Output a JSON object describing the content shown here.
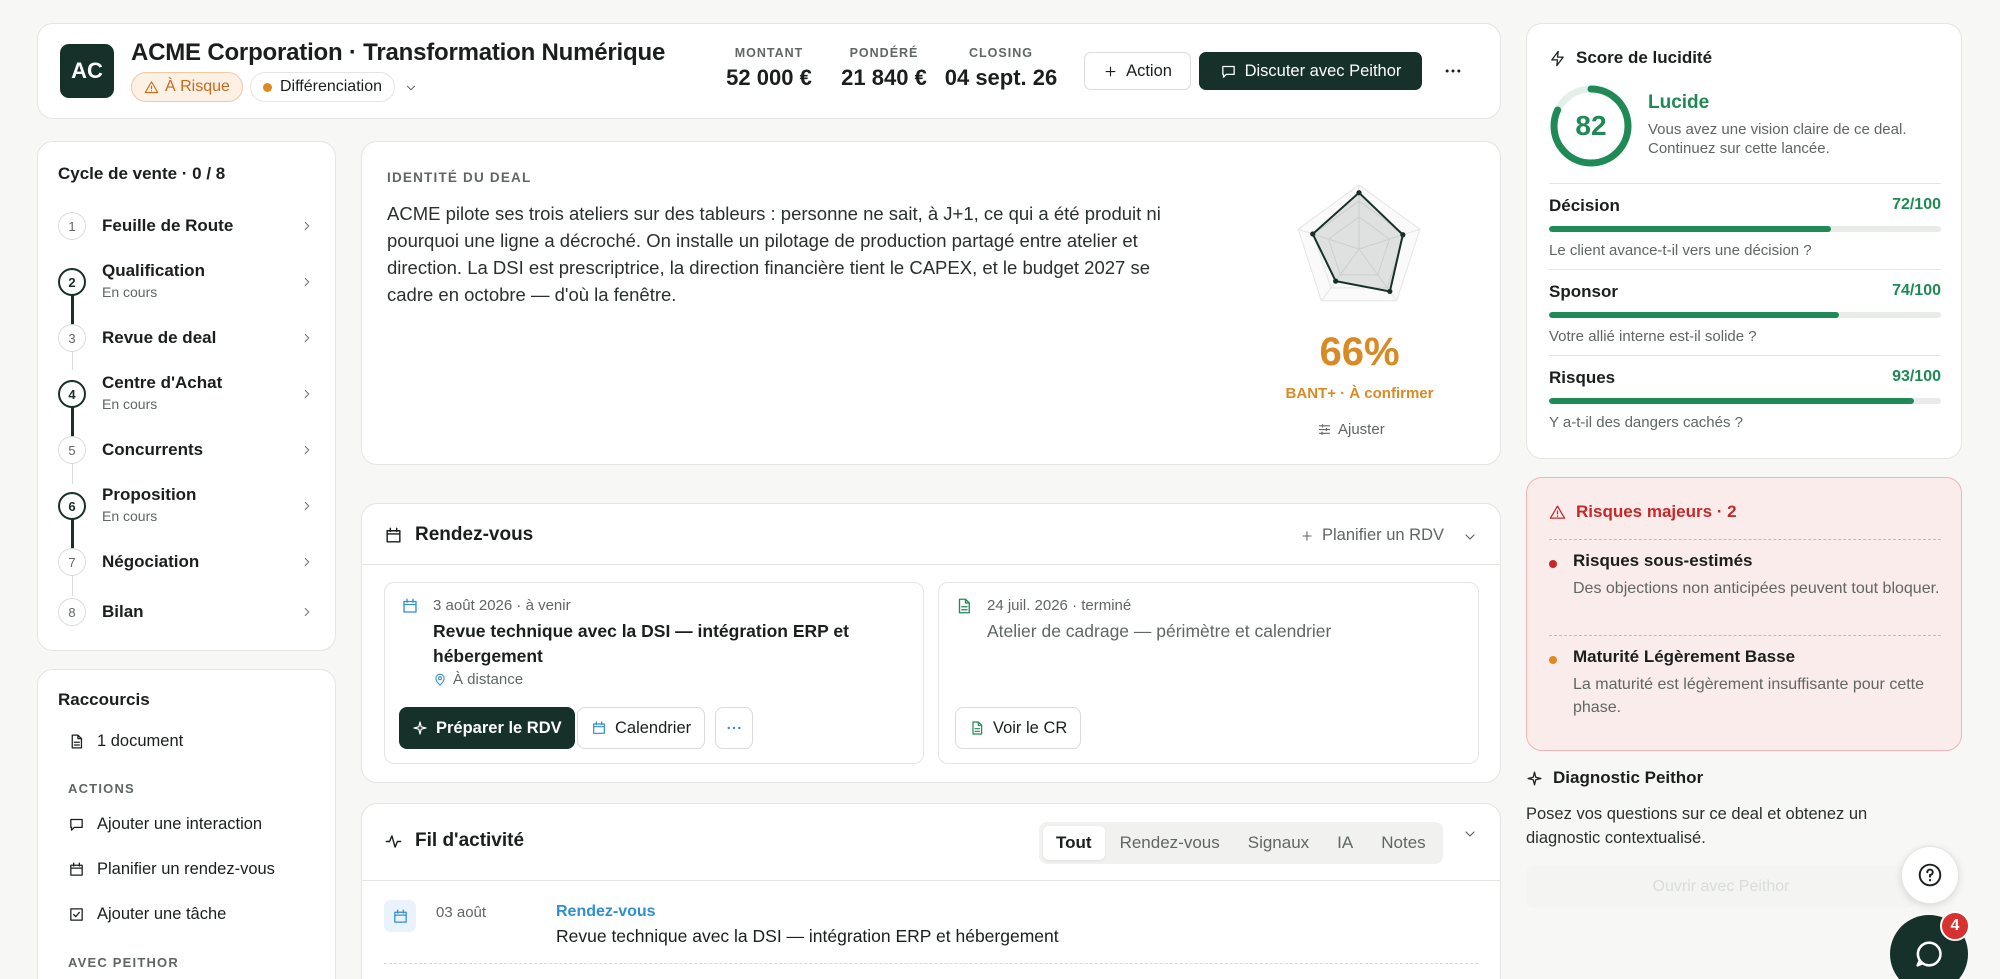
{
  "header": {
    "avatar_initials": "AC",
    "title": "ACME Corporation · Transformation Numérique",
    "risk_badge": "À Risque",
    "stage_badge": "Différenciation",
    "metrics": [
      {
        "label": "MONTANT",
        "value": "52 000 €"
      },
      {
        "label": "PONDÉRÉ",
        "value": "21 840 €"
      },
      {
        "label": "CLOSING",
        "value": "04 sept. 26"
      }
    ],
    "action_label": "Action",
    "discuss_label": "Discuter avec Peithor"
  },
  "cycle": {
    "title": "Cycle de vente · 0 / 8",
    "stages": [
      {
        "num": "1",
        "name": "Feuille de Route",
        "status": ""
      },
      {
        "num": "2",
        "name": "Qualification",
        "status": "En cours"
      },
      {
        "num": "3",
        "name": "Revue de deal",
        "status": ""
      },
      {
        "num": "4",
        "name": "Centre d'Achat",
        "status": "En cours"
      },
      {
        "num": "5",
        "name": "Concurrents",
        "status": ""
      },
      {
        "num": "6",
        "name": "Proposition",
        "status": "En cours"
      },
      {
        "num": "7",
        "name": "Négociation",
        "status": ""
      },
      {
        "num": "8",
        "name": "Bilan",
        "status": ""
      }
    ]
  },
  "shortcuts": {
    "title": "Raccourcis",
    "document": "1 document",
    "actions_label": "ACTIONS",
    "actions": [
      "Ajouter une interaction",
      "Planifier un rendez-vous",
      "Ajouter une tâche"
    ],
    "peithor_label": "AVEC PEITHOR"
  },
  "identity": {
    "label": "IDENTITÉ DU DEAL",
    "text": "ACME pilote ses trois ateliers sur des tableurs : personne ne sait, à J+1, ce qui a été produit ni pourquoi une ligne a décroché. On installe un pilotage de production partagé entre atelier et direction. La DSI est prescriptrice, la direction financière tient le CAPEX, et le budget 2027 se cadre en octobre — d'où la fenêtre.",
    "percent": "66%",
    "bant": "BANT+ · À confirmer",
    "adjust": "Ajuster",
    "radar_values": [
      0.88,
      0.72,
      0.82,
      0.62,
      0.76
    ]
  },
  "rdv": {
    "title": "Rendez-vous",
    "plan_label": "Planifier un RDV",
    "upcoming": {
      "date": "3 août 2026 · à venir",
      "title": "Revue technique avec la DSI — intégration ERP et hébergement",
      "location": "À distance",
      "prepare_label": "Préparer le RDV",
      "calendar_label": "Calendrier"
    },
    "past": {
      "date": "24 juil. 2026 · terminé",
      "title": "Atelier de cadrage — périmètre et calendrier",
      "cr_label": "Voir le CR"
    }
  },
  "activity": {
    "title": "Fil d'activité",
    "tabs": [
      "Tout",
      "Rendez-vous",
      "Signaux",
      "IA",
      "Notes"
    ],
    "items": [
      {
        "date": "03 août",
        "type": "Rendez-vous",
        "text": "Revue technique avec la DSI — intégration ERP et hébergement"
      }
    ]
  },
  "score": {
    "title": "Score de lucidité",
    "value": 82,
    "level": "Lucide",
    "desc": "Vous avez une vision claire de ce deal. Continuez sur cette lancée.",
    "criteria": [
      {
        "name": "Décision",
        "score": "72/100",
        "value": 72,
        "question": "Le client avance-t-il vers une décision ?"
      },
      {
        "name": "Sponsor",
        "score": "74/100",
        "value": 74,
        "question": "Votre allié interne est-il solide ?"
      },
      {
        "name": "Risques",
        "score": "93/100",
        "value": 93,
        "question": "Y a-t-il des dangers cachés ?"
      }
    ],
    "accent": "#1f8a55"
  },
  "risks": {
    "title": "Risques majeurs · 2",
    "items": [
      {
        "title": "Risques sous-estimés",
        "desc": "Des objections non anticipées peuvent tout bloquer.",
        "color": "#c62828"
      },
      {
        "title": "Maturité Légèrement Basse",
        "desc": "La maturité est légèrement insuffisante pour cette phase.",
        "color": "#e08a1e"
      }
    ]
  },
  "diagnostic": {
    "title": "Diagnostic Peithor",
    "text": "Posez vos questions sur ce deal et obtenez un diagnostic contextualisé.",
    "button_label": "Ouvrir avec Peithor"
  },
  "chat_badge": "4"
}
